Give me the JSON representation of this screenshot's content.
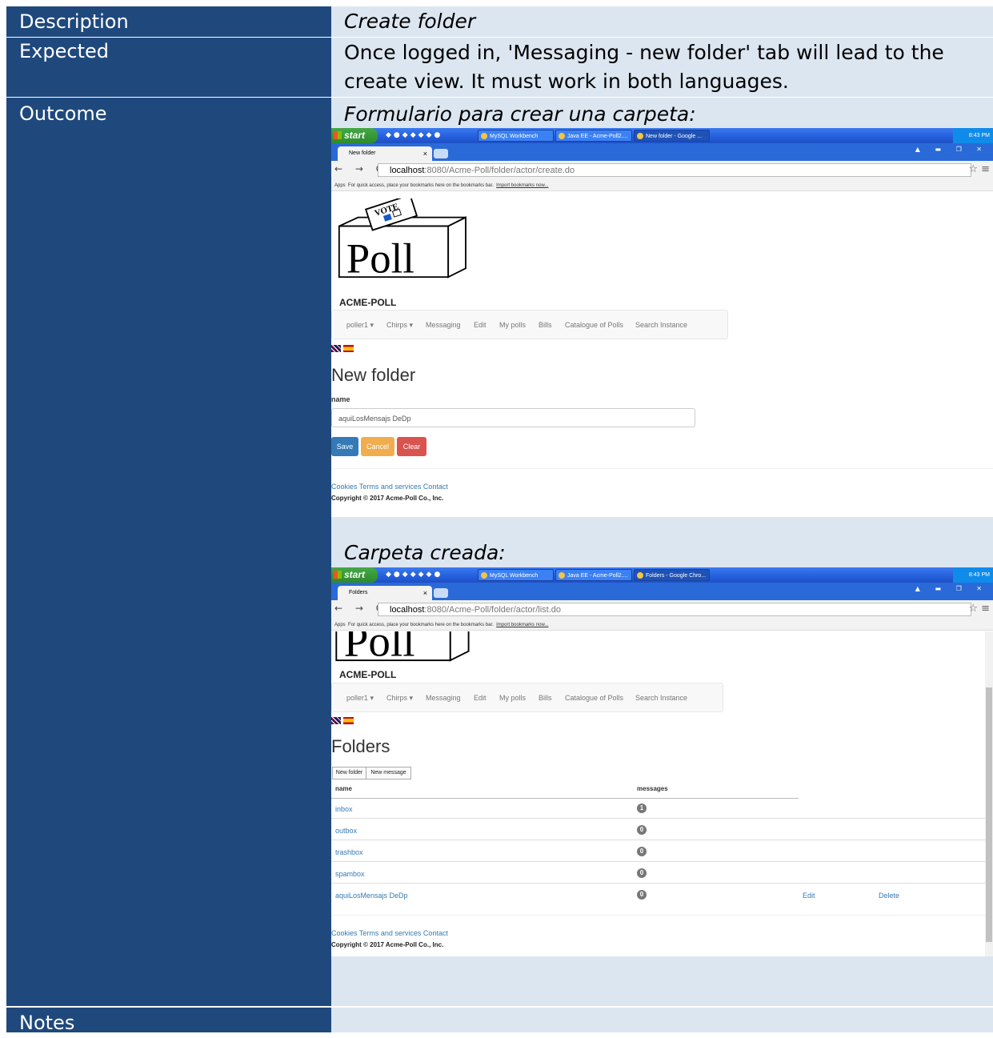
{
  "rows": {
    "description": {
      "label": "Description",
      "value": "Create folder"
    },
    "expected": {
      "label": "Expected",
      "value_line1": "Once logged in, 'Messaging  - new folder' tab will lead to the",
      "value_line2": "create view. It must work in both languages."
    },
    "outcome": {
      "label": "Outcome",
      "caption1": "Formulario para crear una carpeta:",
      "caption2": "Carpeta creada:"
    },
    "notes": {
      "label": "Notes"
    }
  },
  "colors": {
    "label_bg": "#1f497d",
    "value_bg": "#dce6f1",
    "save": "#337ab7",
    "cancel": "#f0ad4e",
    "clear": "#d9534f"
  },
  "taskbar": {
    "start": "start",
    "tasks": [
      "MySQL Workbench",
      "Java EE - Acme-Poll2....",
      "New folder - Google ..."
    ],
    "tasks2": [
      "MySQL Workbench",
      "Java EE - Acme-Poll2....",
      "Folders - Google Chro..."
    ],
    "clock": "8:43 PM"
  },
  "shot1": {
    "tab_title": "New folder",
    "url_host": "localhost",
    "url_rest": ":8080/Acme-Poll/folder/actor/create.do",
    "bookmarks_apps": "Apps",
    "bookmarks_text": "For quick access, place your bookmarks here on the bookmarks bar.",
    "bookmarks_link": "Import bookmarks now...",
    "logo_vote": "VOTE",
    "logo_word": "Poll",
    "brand": "ACME-POLL",
    "menu": [
      "poller1 ▾",
      "Chirps ▾",
      "Messaging",
      "Edit",
      "My polls",
      "Bills",
      "Catalogue of Polls",
      "Search Instance"
    ],
    "heading": "New folder",
    "field_label": "name",
    "field_value": "aquiLosMensajs DeDp",
    "buttons": {
      "save": "Save",
      "cancel": "Cancel",
      "clear": "Clear"
    },
    "footer_links": "Cookies Terms and services Contact",
    "copyright": "Copyright © 2017 Acme-Poll Co., Inc."
  },
  "shot2": {
    "tab_title": "Folders",
    "url_host": "localhost",
    "url_rest": ":8080/Acme-Poll/folder/actor/list.do",
    "logo_word": "Poll",
    "brand": "ACME-POLL",
    "heading": "Folders",
    "buttons": {
      "new_folder": "New folder",
      "new_message": "New message"
    },
    "columns": {
      "name": "name",
      "messages": "messages"
    },
    "folders": [
      {
        "name": "inbox",
        "count": "1"
      },
      {
        "name": "outbox",
        "count": "0"
      },
      {
        "name": "trashbox",
        "count": "0"
      },
      {
        "name": "spambox",
        "count": "0"
      },
      {
        "name": "aquiLosMensajs DeDp",
        "count": "0",
        "edit": "Edit",
        "delete": "Delete"
      }
    ]
  }
}
